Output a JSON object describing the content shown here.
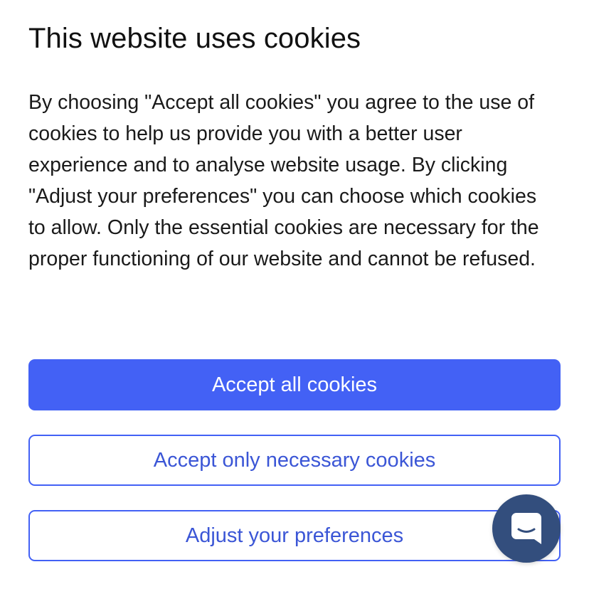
{
  "dialog": {
    "title": "This website uses cookies",
    "body": "By choosing \"Accept all cookies\" you agree to the use of cookies to help us provide you with a better user experience and to analyse website usage. By clicking \"Adjust your preferences\" you can choose which cookies to allow. Only the essential cookies are necessary for the proper functioning of our website and cannot be refused."
  },
  "buttons": {
    "accept_all": "Accept all cookies",
    "accept_necessary": "Accept only necessary cookies",
    "adjust": "Adjust your preferences"
  },
  "chat_launcher": {
    "icon": "chat-bubble-icon",
    "background": "#334e7d"
  },
  "colors": {
    "accent": "#4361f5",
    "accent_text": "#3b56d6",
    "primary_text": "#111111"
  }
}
